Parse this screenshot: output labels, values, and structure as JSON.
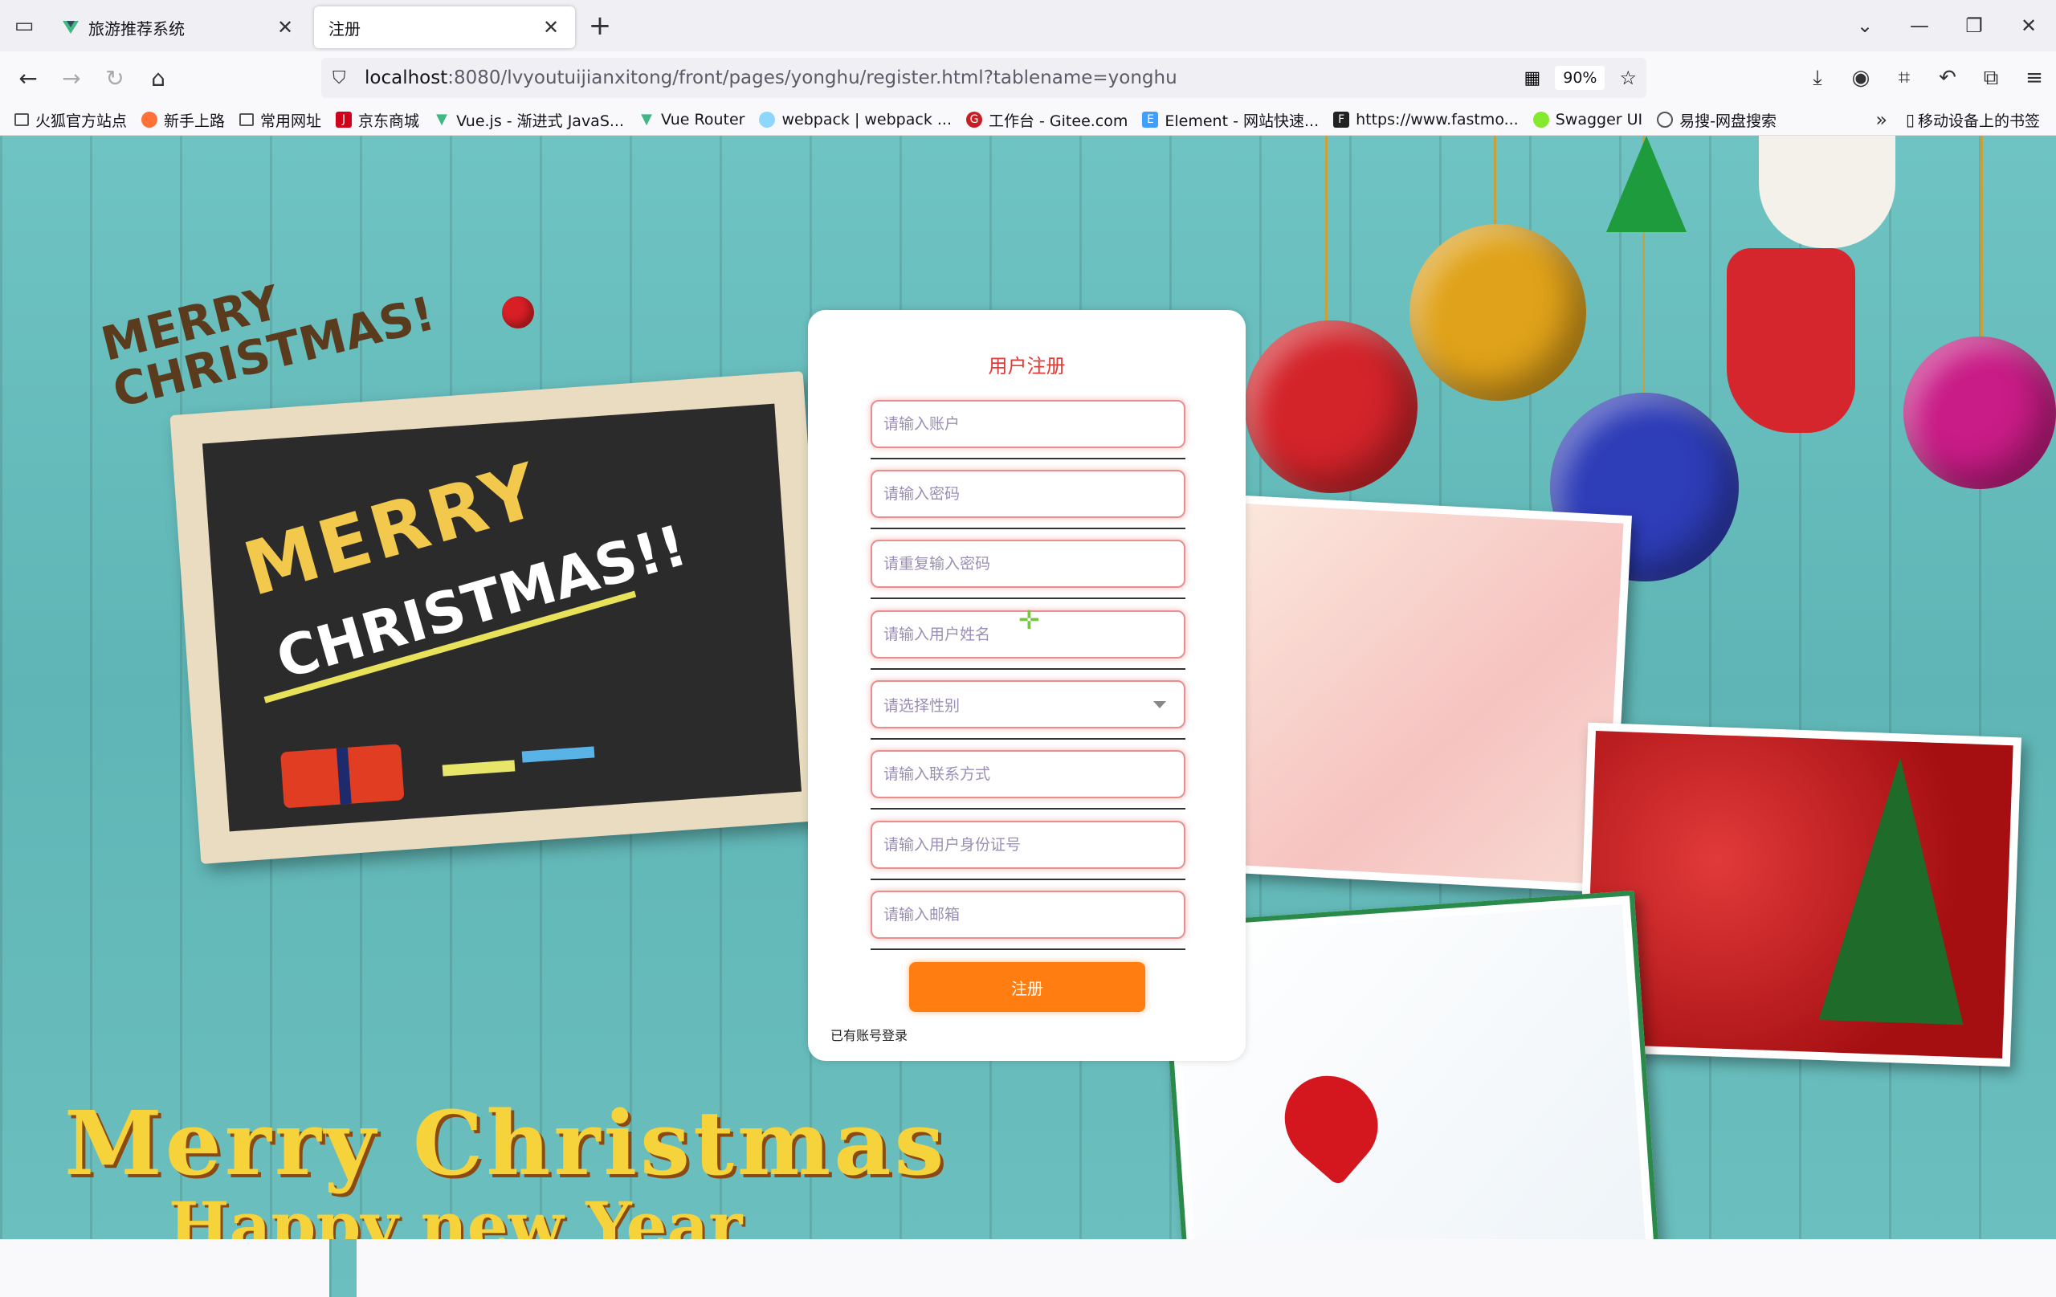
{
  "browser": {
    "tabs": [
      {
        "title": "旅游推荐系统",
        "active": false
      },
      {
        "title": "注册",
        "active": true
      }
    ],
    "url_host": "localhost",
    "url_rest": ":8080/lvyoutuijianxitong/front/pages/yonghu/register.html?tablename=yonghu",
    "zoom": "90%",
    "bookmarks": [
      {
        "label": "火狐官方站点",
        "icon": "folder-icon"
      },
      {
        "label": "新手上路",
        "icon": "firefox-icon"
      },
      {
        "label": "常用网址",
        "icon": "folder-icon"
      },
      {
        "label": "京东商城",
        "icon": "jd-icon"
      },
      {
        "label": "Vue.js - 渐进式 JavaS...",
        "icon": "vue-icon"
      },
      {
        "label": "Vue Router",
        "icon": "vue-icon"
      },
      {
        "label": "webpack | webpack ...",
        "icon": "webpack-icon"
      },
      {
        "label": "工作台 - Gitee.com",
        "icon": "gitee-icon"
      },
      {
        "label": "Element - 网站快速...",
        "icon": "element-icon"
      },
      {
        "label": "https://www.fastmo...",
        "icon": "fastmock-icon"
      },
      {
        "label": "Swagger UI",
        "icon": "swagger-icon"
      },
      {
        "label": "易搜-网盘搜索",
        "icon": "globe-icon"
      }
    ],
    "mobile_bookmarks": "移动设备上的书签"
  },
  "background": {
    "doodle": "MERRY CHRISTMAS!",
    "chalk_merry": "MERRY",
    "chalk_christmas": "CHRISTMAS!!",
    "big_merry": "Merry Christmas",
    "big_happy": "Happy new Year"
  },
  "register": {
    "title": "用户注册",
    "fields": {
      "account": "请输入账户",
      "password": "请输入密码",
      "password_repeat": "请重复输入密码",
      "name": "请输入用户姓名",
      "gender": "请选择性别",
      "phone": "请输入联系方式",
      "id_card": "请输入用户身份证号",
      "email": "请输入邮箱"
    },
    "submit": "注册",
    "login_link": "已有账号登录"
  },
  "colors": {
    "title_red": "#e53935",
    "button_orange": "#ff7d11",
    "field_border": "#e98d8d",
    "wood_teal": "#5fb5b5"
  }
}
